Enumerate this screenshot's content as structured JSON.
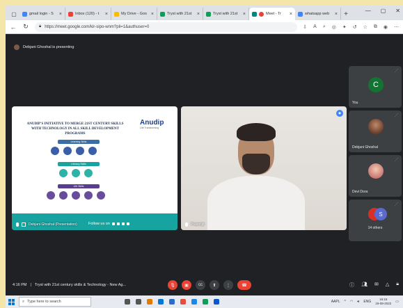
{
  "browser": {
    "tabs": [
      {
        "title": "gmail login - S",
        "color": "#4285f4",
        "active": false
      },
      {
        "title": "Inbox (120) - t",
        "color": "#ea4335",
        "active": false
      },
      {
        "title": "My Drive - Goo",
        "color": "#fbbc04",
        "active": false
      },
      {
        "title": "Tryst with 21st",
        "color": "#0f9d58",
        "active": false
      },
      {
        "title": "Tryst with 21st",
        "color": "#0f9d58",
        "active": false
      },
      {
        "title": "Meet - Tr",
        "color": "#00897b",
        "active": true
      },
      {
        "title": "whatsapp web",
        "color": "#4285f4",
        "active": false
      }
    ],
    "new_tab": "+",
    "url": "https://meet.google.com/kir-sipo-wnm?pli=1&authuser=0"
  },
  "meet": {
    "presenting_banner": "Debjani Ghoshal is presenting",
    "slide": {
      "title": "ANUDIP'S INITIATIVE TO MERGE 21ST CENTURY SKILLS WITH TECHNOLOGY IN ALL SKILL DEVELOPMENT PROGRAMS",
      "logo_text": "Anudip",
      "logo_subtext": "Life Transforming",
      "sections": [
        "Learning Skills",
        "Literacy Skills",
        "Life Skills"
      ],
      "follow_text": "Follow us on"
    },
    "presentation_label": "Debjani Ghoshal (Presentation)",
    "camera_label": "Prasenjit",
    "participants": [
      {
        "name": "You",
        "initial": "C"
      },
      {
        "name": "Debjani Ghoshal"
      },
      {
        "name": "Devi Dora"
      }
    ],
    "others": {
      "initial": "S",
      "label": "14 others"
    },
    "meeting_time": "4:16 PM",
    "meeting_separator": "|",
    "meeting_title": "Tryst with 21st century skills & Technology - New Ag..."
  },
  "taskbar": {
    "search_placeholder": "Type here to search",
    "stock": "AAPL",
    "lang": "ENG",
    "time": "16:16",
    "date": "19-08-2022"
  }
}
